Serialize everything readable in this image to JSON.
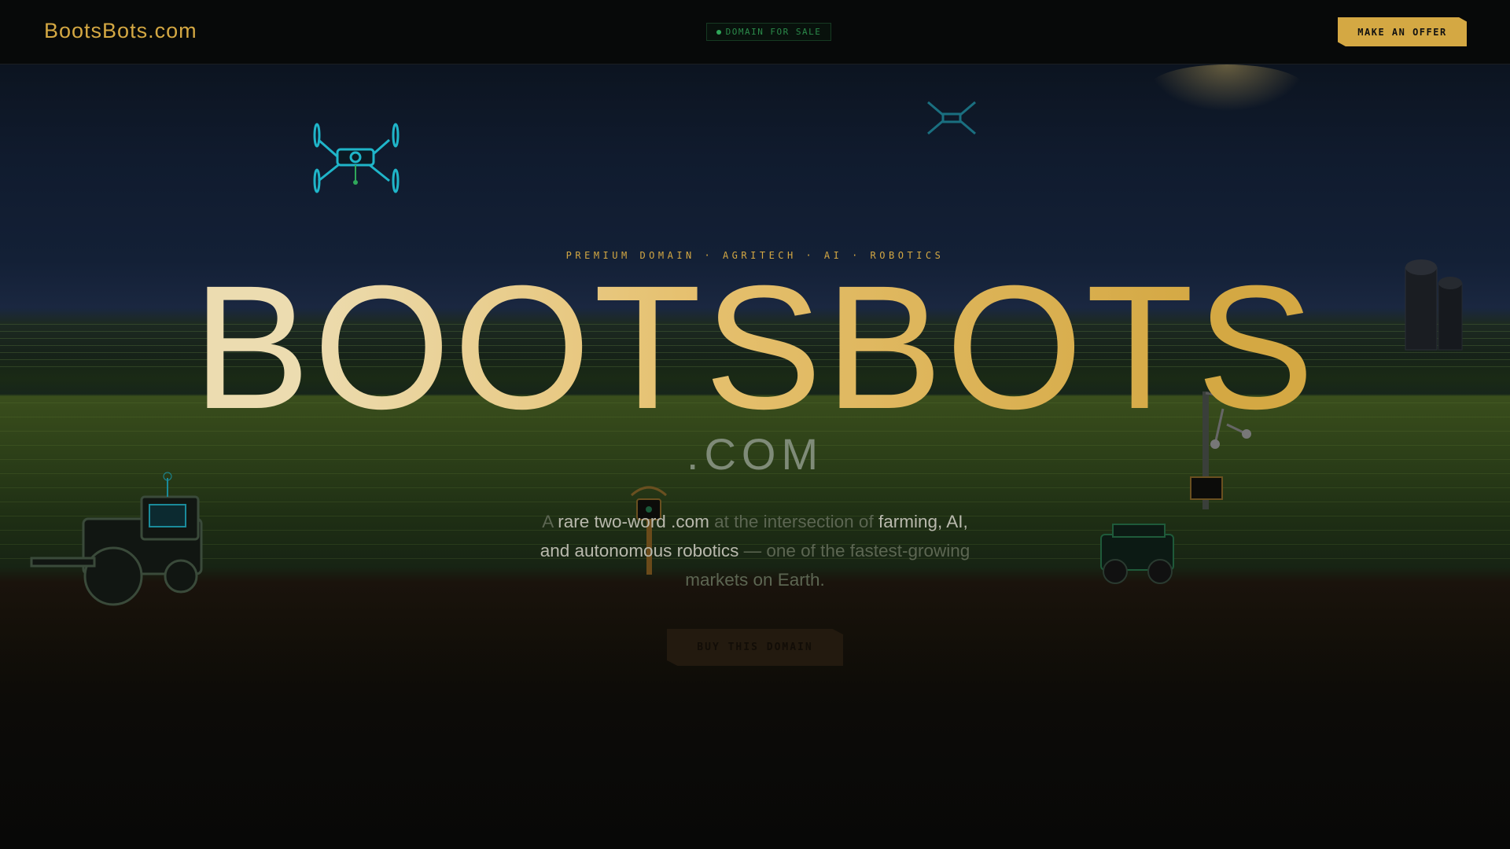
{
  "header": {
    "logo": "BootsBots.com",
    "badge": "DOMAIN FOR SALE",
    "offer_button": "MAKE AN OFFER"
  },
  "hero": {
    "tagline": "PREMIUM DOMAIN · AGRITECH · AI · ROBOTICS",
    "title": "BOOTSBOTS",
    "tld": ".COM",
    "description": {
      "p1": "A ",
      "h1": "rare two-word .com",
      "p2": " at the intersection of ",
      "h2": "farming, AI, and autonomous robotics",
      "p3": " — one of the fastest-growing markets on Earth."
    },
    "cta": "BUY THIS DOMAIN"
  },
  "colors": {
    "accent": "#d4a843",
    "status": "#2fa85a",
    "drone": "#1fb5c9"
  }
}
